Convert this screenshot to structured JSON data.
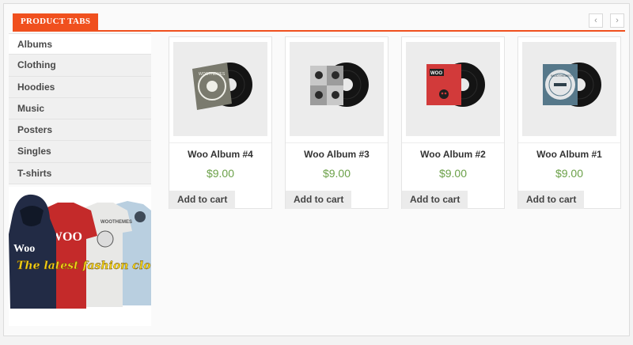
{
  "header": {
    "title": "PRODUCT TABS",
    "prev_icon": "‹",
    "next_icon": "›"
  },
  "categories": [
    {
      "label": "Albums"
    },
    {
      "label": "Clothing"
    },
    {
      "label": "Hoodies"
    },
    {
      "label": "Music"
    },
    {
      "label": "Posters"
    },
    {
      "label": "Singles"
    },
    {
      "label": "T-shirts"
    }
  ],
  "banner": {
    "woo_text": "Woo",
    "tagline": "The latest fashion clothing",
    "shirt_text": "WOO",
    "tee_text": "WOOTHEMES"
  },
  "products": [
    {
      "name": "Woo Album #4",
      "price": "$9.00",
      "cart_label": "Add to cart",
      "sleeve_color": "#7a7a6e",
      "sleeve_text": "WOOTHEMES"
    },
    {
      "name": "Woo Album #3",
      "price": "$9.00",
      "cart_label": "Add to cart",
      "sleeve_color": "#9c9c9c",
      "sleeve_text": ""
    },
    {
      "name": "Woo Album #2",
      "price": "$9.00",
      "cart_label": "Add to cart",
      "sleeve_color": "#d23a3a",
      "sleeve_text": "WOO"
    },
    {
      "name": "Woo Album #1",
      "price": "$9.00",
      "cart_label": "Add to cart",
      "sleeve_color": "#56788a",
      "sleeve_text": "WOOTHEMES"
    }
  ],
  "colors": {
    "accent": "#f0501e",
    "price": "#6ba048"
  }
}
